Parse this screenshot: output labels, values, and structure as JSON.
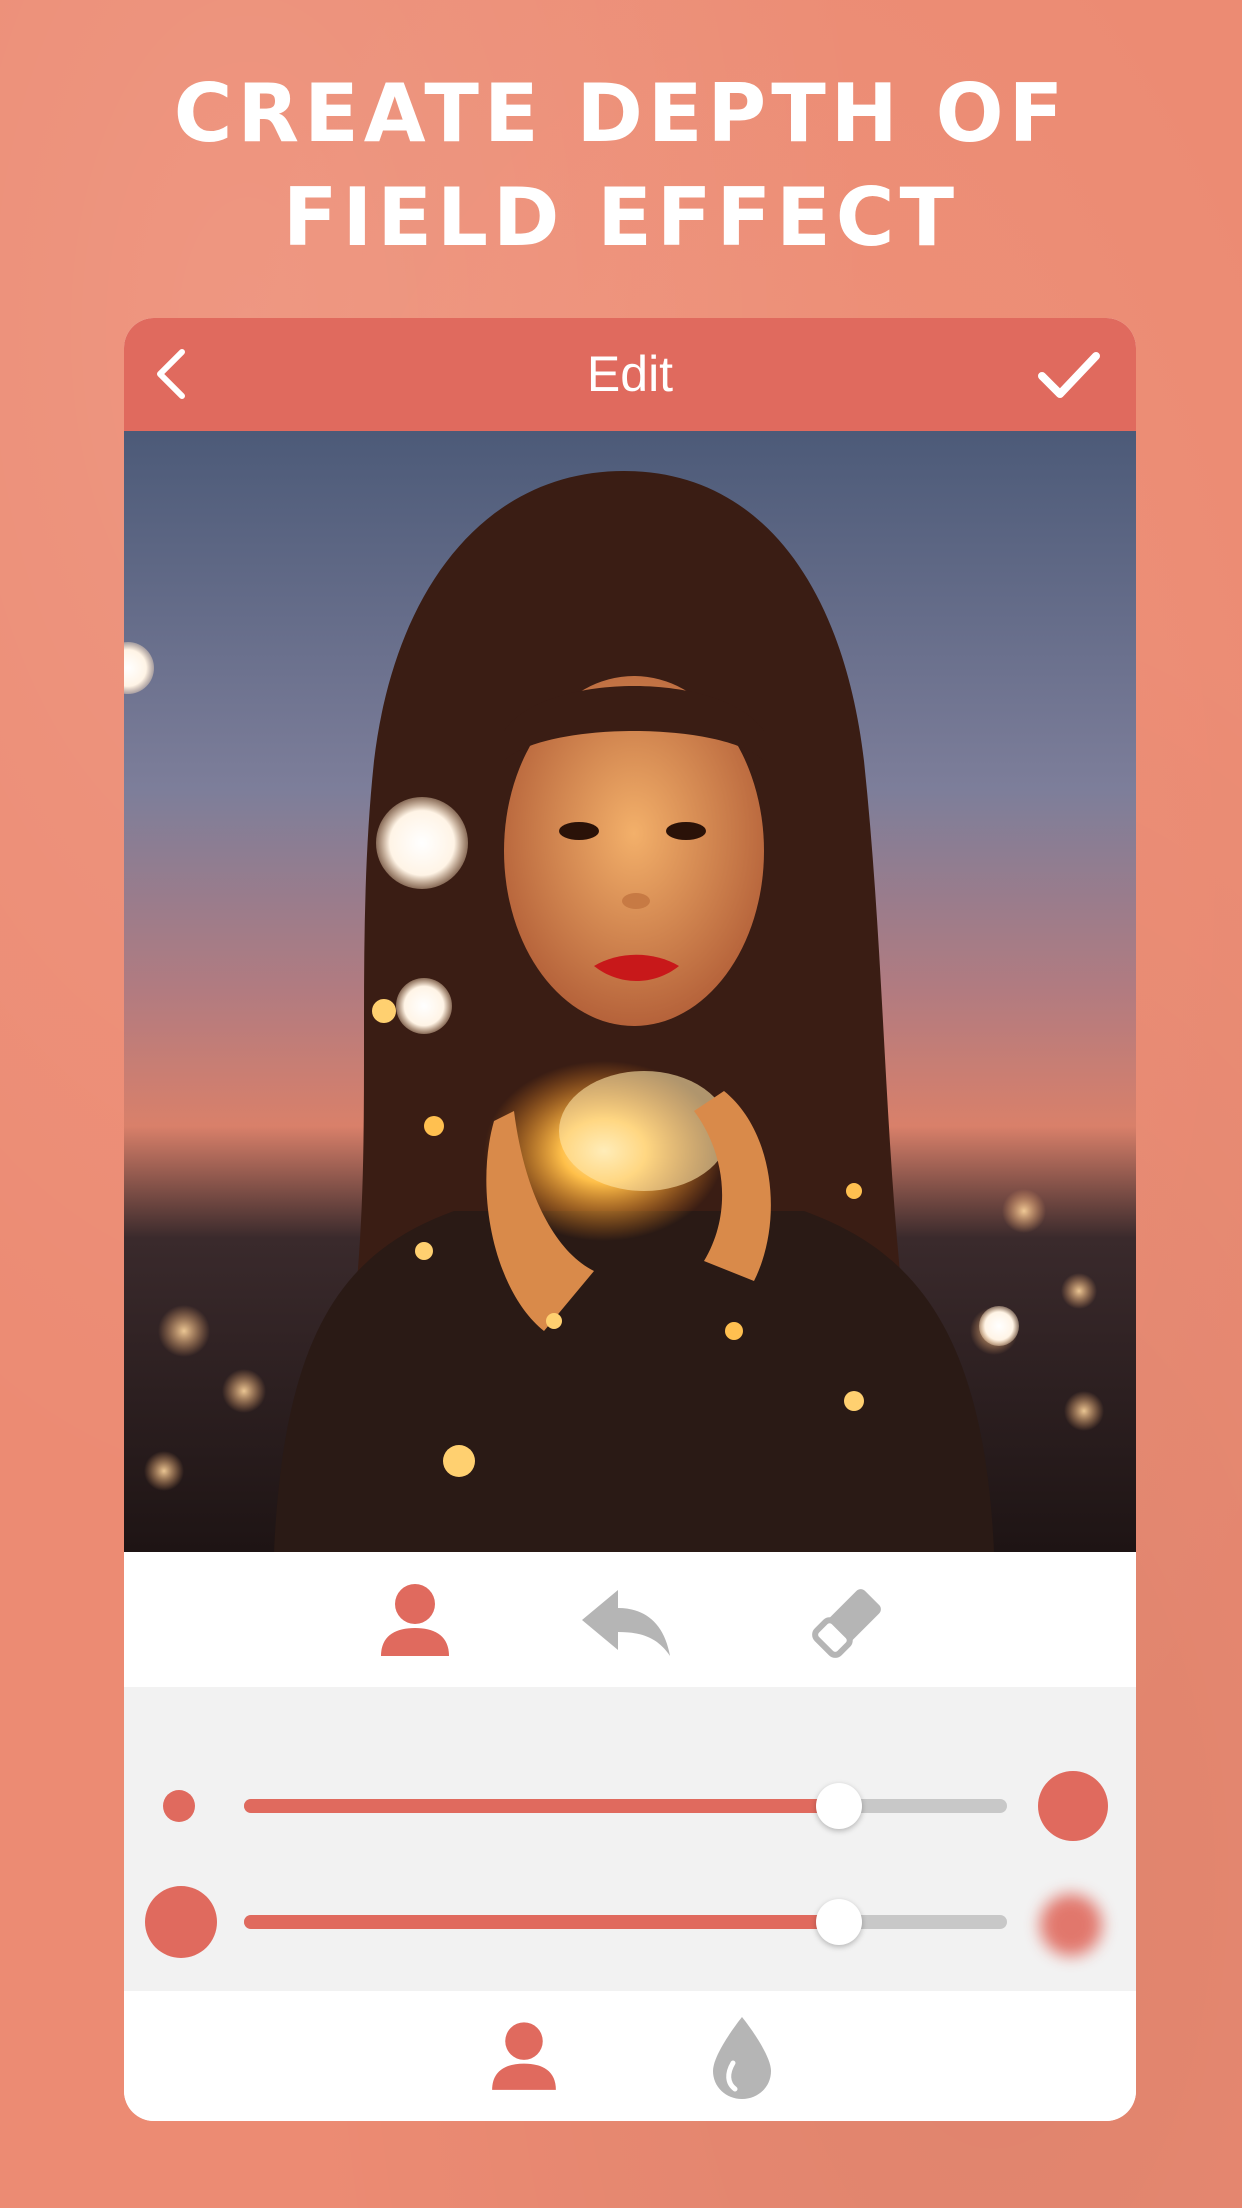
{
  "headline": {
    "line1": "CREATE DEPTH OF",
    "line2": "FIELD EFFECT"
  },
  "topbar": {
    "title": "Edit",
    "back_icon": "chevron-left-icon",
    "done_icon": "checkmark-icon"
  },
  "photo": {
    "subject": "person-with-string-lights"
  },
  "toolbar": {
    "tools": [
      "person-icon",
      "undo-icon",
      "eraser-icon"
    ],
    "active_tool": "person-icon"
  },
  "sliders": {
    "brush_size": {
      "min_icon": "small-dot-icon",
      "max_icon": "large-dot-icon",
      "value_percent": 78
    },
    "blur_amount": {
      "min_icon": "sharp-dot-icon",
      "max_icon": "blurred-dot-icon",
      "value_percent": 78
    }
  },
  "bottombar": {
    "tabs": [
      "person-icon",
      "droplet-icon"
    ],
    "active_tab": "person-icon"
  },
  "colors": {
    "background": "#ec8b73",
    "accent": "#e06a5e",
    "inactive": "#b5b5b5",
    "panel": "#f2f2f2"
  }
}
